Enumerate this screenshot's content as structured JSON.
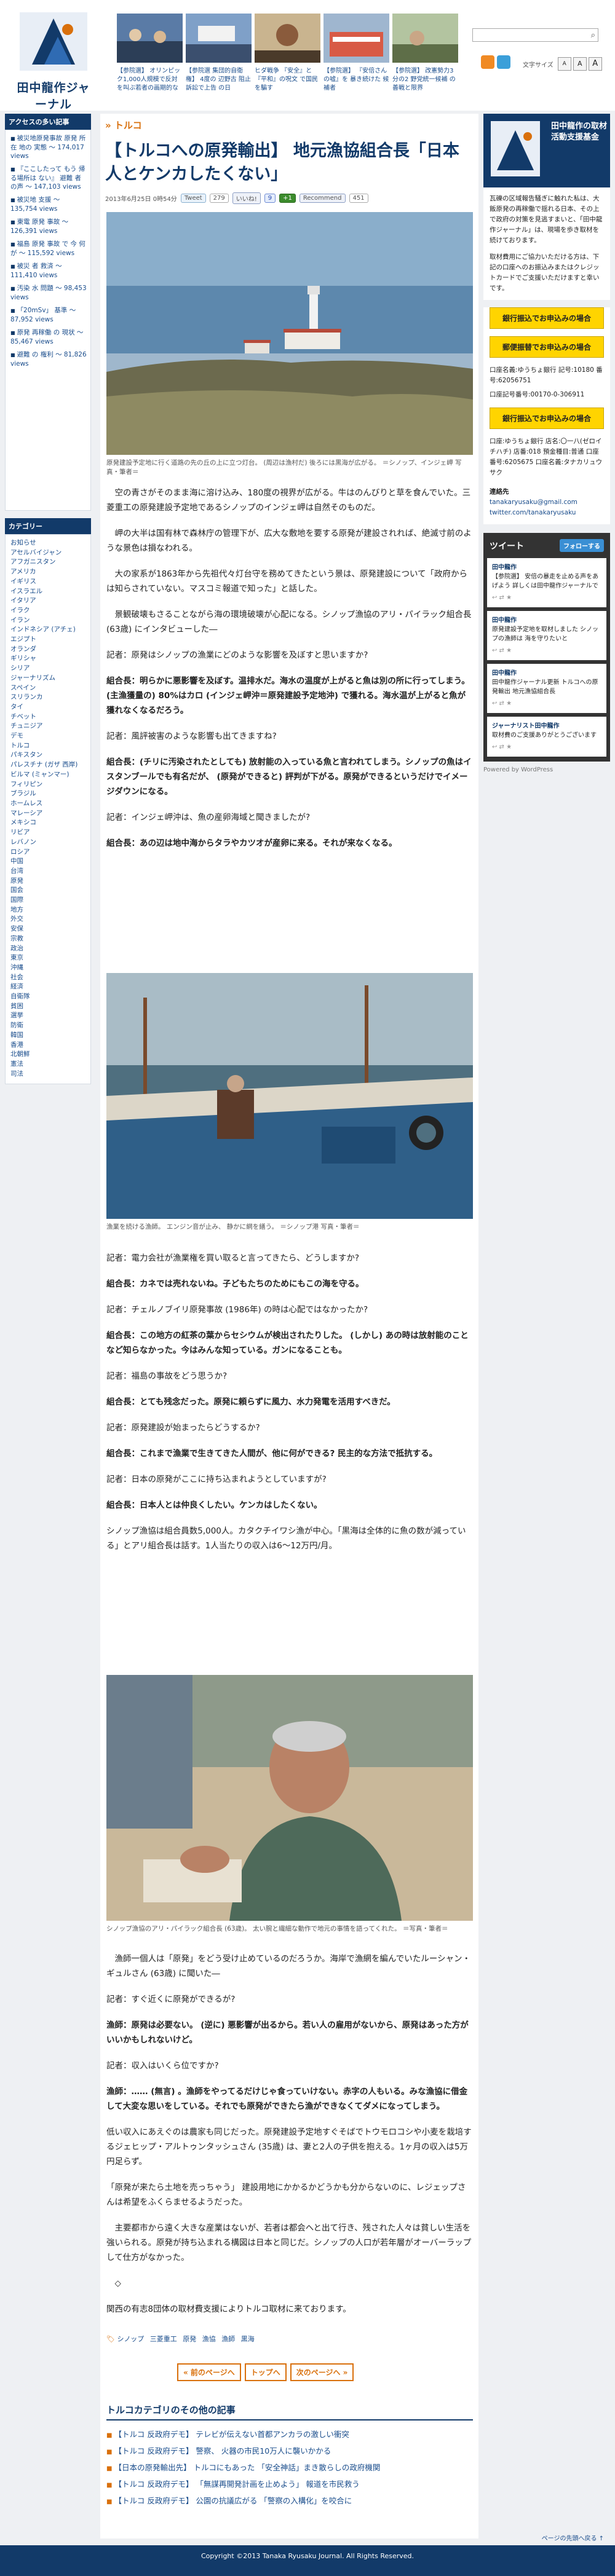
{
  "site": {
    "name": "田中龍作ジャーナル"
  },
  "header": {
    "thumbs": [
      {
        "caption": "【参院選】 オリンピック1,000人規模で反対を叫ぶ若者の画期的な"
      },
      {
        "caption": "【参院選 集団的自衛権】 4度の 辺野古 阻止訴訟で上告 の日"
      },
      {
        "caption": "ヒダ戦争 『安全』と『平和』の呪文 で国民を騙す"
      },
      {
        "caption": "【参院選】 『安倍さんの嘘』を 暴き続けた 候補者"
      },
      {
        "caption": "【参院選】 改憲勢力3分の2 野党統一候補 の善戦と限界"
      },
      {
        "caption": "【参院選】 市民と野党の 共闘 その後の 行方"
      }
    ],
    "search_placeholder": "",
    "fontsize_label": "文字サイズ",
    "fontsize_buttons": [
      "A",
      "A",
      "A"
    ]
  },
  "left": {
    "ranking_title": "アクセスの多い記事",
    "ranking": [
      "被災地原発事故 原発 所在 地の 実態 ～ 174,017 views",
      "『ここしたって もう 帰る場所は ない』 避難 者の声 ～ 147,103 views",
      "被災地 支援 ～ 135,754 views",
      "東電 原発 事故 ～ 126,391 views",
      "福島 原発 事故 で 今 何が ～ 115,592 views",
      "被災 者 救済 ～ 111,410 views",
      "汚染 水 問題 ～ 98,453 views",
      "「20mSv」 基準 ～ 87,952 views",
      "原発 再稼働 の 現状 ～ 85,467 views",
      "避難 の 権利 ～ 81,826 views"
    ],
    "category_title": "カテゴリー",
    "categories": [
      "お知らせ",
      "アセルバイジャン",
      "アフガニスタン",
      "アメリカ",
      "イギリス",
      "イスラエル",
      "イタリア",
      "イラク",
      "イラン",
      "インドネシア (アチェ)",
      "エジプト",
      "オランダ",
      "ギリシャ",
      "シリア",
      "ジャーナリズム",
      "スペイン",
      "スリランカ",
      "タイ",
      "チベット",
      "チュニジア",
      "デモ",
      "トルコ",
      "パキスタン",
      "パレスチナ (ガザ 西岸)",
      "ビルマ (ミャンマー)",
      "フィリピン",
      "ブラジル",
      "ホームレス",
      "マレーシア",
      "メキシコ",
      "リビア",
      "レバノン",
      "ロシア",
      "中国",
      "台湾",
      "原発",
      "国会",
      "国際",
      "地方",
      "外交",
      "安保",
      "宗教",
      "政治",
      "東京",
      "沖縄",
      "社会",
      "経済",
      "自衛隊",
      "貧困",
      "選挙",
      "防衛",
      "韓国",
      "香港",
      "北朝鮮",
      "憲法",
      "司法"
    ]
  },
  "article": {
    "breadcrumb": "» トルコ",
    "title": "【トルコへの原発輸出】 地元漁協組合長「日本人とケンカしたくない」",
    "date": "2013年6月25日 0時54分",
    "tweet_label": "Tweet",
    "tweet_count": "279",
    "like_label": "いいね!",
    "hatena_count": "9",
    "gplus_label": "+1",
    "recommend_label": "Recommend",
    "recommend_count": "451",
    "photo1_caption": "原発建設予定地に行く道路の先の丘の上に立つ灯台。 (周辺は漁村だ) 後ろには黒海が広がる。 ＝シノップ、インジェ岬 写真・筆者＝",
    "photo2_caption": "漁業を続ける漁師。 エンジン音が止み、 静かに網を繕う。 ＝シノップ港 写真・筆者＝",
    "photo3_caption": "シノップ漁協のアリ・パイラック組合長 (63歳)。 太い腕と繊細な動作で地元の事情を語ってくれた。 ＝写真・筆者＝",
    "paragraphs": [
      {
        "text": "　空の青さがそのまま海に溶け込み、180度の視界が広がる。牛はのんびりと草を食んでいた。三菱重工の原発建設予定地であるシノップのインジェ岬は自然そのものだ。",
        "bold": false
      },
      {
        "text": "　岬の大半は国有林で森林庁の管理下が、広大な敷地を要する原発が建設されれば、絶滅寸前のような景色は損なわれる。",
        "bold": false
      },
      {
        "text": "　大の家系が1863年から先祖代々灯台守を務めてきたという景は、原発建設について「政府からは知らされていない。マスコミ報道で知った」と話した。",
        "bold": false
      },
      {
        "text": "　景観破壊もさることながら海の環境破壊が心配になる。シノップ漁協のアリ・パイラック組合長 (63歳) にインタビューした―",
        "bold": false
      },
      {
        "text": "記者：原発はシノップの漁業にどのような影響を及ぼすと思いますか?",
        "bold": false
      },
      {
        "text": "組合長：明らかに悪影響を及ぼす。温排水だ。海水の温度が上がると魚は別の所に行ってしまう。 (主漁獲量の) 80%はカロ (インジェ岬沖＝原発建設予定地沖) で獲れる。海水温が上がると魚が獲れなくなるだろう。",
        "bold": true
      },
      {
        "text": "記者：風評被害のような影響も出てきますね?",
        "bold": false
      },
      {
        "text": "組合長：(チリに汚染されたとしても) 放射能の入っている魚と言われてしまう。シノップの魚はイスタンブールでも有名だが、 (原発ができると) 評判が下がる。原発ができるというだけでイメージダウンになる。",
        "bold": true
      },
      {
        "text": "記者：インジェ岬沖は、魚の産卵海域と聞きましたが?",
        "bold": false
      },
      {
        "text": "組合長：あの辺は地中海からタラやカツオが産卵に来る。それが来なくなる。",
        "bold": true
      },
      {
        "text": "記者：電力会社が漁業権を買い取ると言ってきたら、どうしますか?",
        "bold": false
      },
      {
        "text": "組合長：カネでは売れないね。子どもたちのためにもこの海を守る。",
        "bold": true
      },
      {
        "text": "記者：チェルノブイリ原発事故 (1986年) の時は心配ではなかったか?",
        "bold": false
      },
      {
        "text": "組合長：この地方の紅茶の葉からセシウムが検出されたりした。 (しかし) あの時は放射能のことなど知らなかった。今はみんな知っている。ガンになることも。",
        "bold": true
      },
      {
        "text": "記者：福島の事故をどう思うか?",
        "bold": false
      },
      {
        "text": "組合長：とても残念だった。原発に頼らずに風力、水力発電を活用すべきだ。",
        "bold": true
      },
      {
        "text": "記者：原発建設が始まったらどうするか?",
        "bold": false
      },
      {
        "text": "組合長：これまで漁業で生きてきた人間が、他に何ができる? 民主的な方法で抵抗する。",
        "bold": true
      },
      {
        "text": "記者：日本の原発がここに持ち込まれようとしていますが?",
        "bold": false
      },
      {
        "text": "組合長：日本人とは仲良くしたい。ケンカはしたくない。",
        "bold": true
      },
      {
        "text": "シノップ漁協は組合員数5,000人。カタクチイワシ漁が中心。「黒海は全体的に魚の数が減っている」とアリ組合長は話す。1人当たりの収入は6～12万円/月。",
        "bold": false
      },
      {
        "text": "　漁師一個人は「原発」をどう受け止めているのだろうか。海岸で漁網を編んでいたルーシャン・ギュルさん (63歳) に聞いた―",
        "bold": false
      },
      {
        "text": "記者：すぐ近くに原発ができるが?",
        "bold": false
      },
      {
        "text": "漁師：原発は必要ない。 (逆に) 悪影響が出るから。若い人の雇用がないから、原発はあった方がいいかもしれないけど。",
        "bold": true
      },
      {
        "text": "記者：収入はいくら位ですか?",
        "bold": false
      },
      {
        "text": "漁師：…… (無言) 。漁師をやってるだけじゃ食っていけない。赤字の人もいる。みな漁協に借金して大変な思いをしている。それでも原発ができたら漁ができなくてダメになってしまう。",
        "bold": true
      },
      {
        "text": "低い収入にあえぐのは農家も同じだった。原発建設予定地すぐそばでトウモロコシや小麦を栽培するジェヒップ・アルトゥンタッシュさん (35歳) は、妻と2人の子供を抱える。1ヶ月の収入は5万円足らず。",
        "bold": false
      },
      {
        "text": "「原発が来たら土地を売っちゃう」 建設用地にかかるかどうかも分からないのに、レジェップさんは希望をふくらませるようだった。",
        "bold": false
      },
      {
        "text": "　主要都市から遠く大きな産業はないが、若者は都会へと出て行き、残された人々は貧しい生活を強いられる。原発が持ち込まれる構図は日本と同じだ。シノップの人口が若年層がオーバーラップして仕方がなかった。",
        "bold": false
      },
      {
        "text": "　◇",
        "bold": false
      },
      {
        "text": "関西の有志8団体の取材費支援によりトルコ取材に来ております。",
        "bold": false
      }
    ],
    "tags": [
      "シノップ",
      "三菱重工",
      "原発",
      "漁協",
      "漁師",
      "黒海"
    ],
    "pager": [
      "« 前のページへ",
      "トップへ",
      "次のページへ »"
    ],
    "related_title": "トルコカテゴリのその他の記事",
    "related": [
      "【トルコ 反政府デモ】 テレビが伝えない首都アンカラの激しい衝突",
      "【トルコ 反政府デモ】 警察、 火器の市民10万人に襲いかかる",
      "【日本の原発輸出先】 トルコにもあった 「安全神話」まき散らしの政府機関",
      "【トルコ 反政府デモ】 「無謀再開発計画を止めよう」 報道を市民救う",
      "【トルコ 反政府デモ】 公園の抗議広がる 「警察の入構化」を咬合に"
    ]
  },
  "right": {
    "banner_title": "田中龍作の取材活動支援基金",
    "intro": "瓦礫の区域報告騒ぎに触れた私は、大飯原発の再稼働で揺れる日本、その上で政府の対策を見逃すまいと、「田中龍作ジャーナル」は、現場を歩き取材を続けております。",
    "intro2": "取材費用にご協力いただける方は、下記の口座へのお振込みまたはクレジットカードでご支援いただけますと幸いです。",
    "btn1": "銀行振込でお申込みの場合",
    "btn2": "郵便振替でお申込みの場合",
    "btn3": "銀行振込でお申込みの場合",
    "bank1": "口座名義:ゆうちょ銀行 記号:10180 番号:62056751",
    "bank2": "口座記号番号:00170-0-306911",
    "bank3": "口座:ゆうちょ銀行 店名:〇一八(ゼロイチハチ) 店番:018 預金種目:普通 口座番号:6205675 口座名義:タナカリュウサク",
    "contact_title": "連絡先",
    "contact_email": "tanakaryusaku@gmail.com",
    "contact_twitter": "twitter.com/tanakaryusaku",
    "tw_title": "ツイート",
    "tw_follow": "フォローする",
    "tweets": [
      {
        "who": "田中龍作",
        "text": "【参院選】 安倍の暴走を止める声をあげよう 詳しくは田中龍作ジャーナルで"
      },
      {
        "who": "田中龍作",
        "text": "原発建設予定地を取材しました シノップの漁師は 海を守りたいと"
      },
      {
        "who": "田中龍作",
        "text": "田中龍作ジャーナル更新 トルコへの原発輸出 地元漁協組合長"
      },
      {
        "who": "ジャーナリスト田中龍作",
        "text": "取材費のご支援ありがとうございます"
      }
    ],
    "powered": "Powered by WordPress"
  },
  "footer": {
    "copyright": "Copyright ©2013 Tanaka Ryusaku Journal. All Rights Reserved.",
    "back_top": "ページの先頭へ戻る ↑"
  }
}
